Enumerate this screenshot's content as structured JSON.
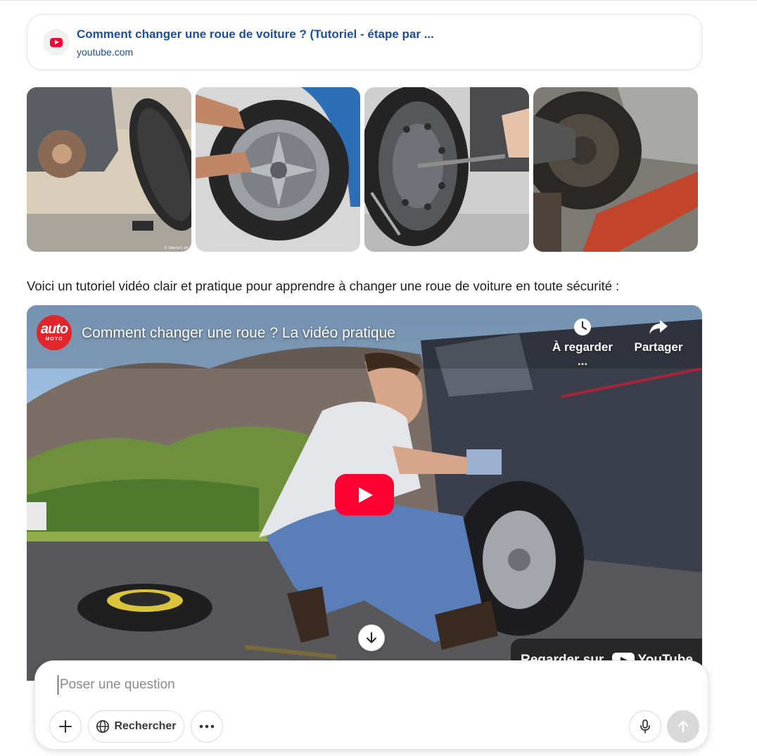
{
  "source": {
    "icon": "youtube-icon",
    "title": "Comment changer une roue de voiture ? (Tutoriel - étape par ...",
    "domain": "youtube.com"
  },
  "thumbnails": [
    {
      "id": "thumb-1",
      "caption": "© bilanol | str"
    },
    {
      "id": "thumb-2"
    },
    {
      "id": "thumb-3"
    },
    {
      "id": "thumb-4"
    }
  ],
  "intro_text": "Voici un tutoriel vidéo clair et pratique pour apprendre à changer une roue de voiture en toute sécurité :",
  "video": {
    "channel_logo_top": "auto",
    "channel_logo_bottom": "MOTO",
    "title": "Comment changer une roue ? La vidéo pratique",
    "watch_later_label": "À regarder ...",
    "share_label": "Partager",
    "watch_on_label": "Regarder sur",
    "watch_on_brand": "YouTube"
  },
  "composer": {
    "placeholder": "Poser une question",
    "value": "",
    "search_label": "Rechercher"
  },
  "colors": {
    "link": "#1a4f9c",
    "youtube_red": "#ff0033",
    "send_disabled": "#d9d9d9"
  }
}
